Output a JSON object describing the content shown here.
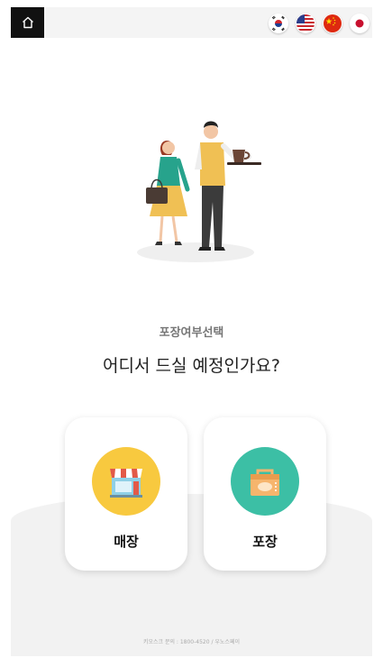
{
  "header": {
    "home_icon": "home-icon",
    "languages": [
      {
        "name": "korean-flag-icon"
      },
      {
        "name": "us-flag-icon"
      },
      {
        "name": "china-flag-icon"
      },
      {
        "name": "japan-flag-icon"
      }
    ]
  },
  "main": {
    "subtitle": "포장여부선택",
    "title": "어디서 드실 예정인가요?"
  },
  "options": [
    {
      "label": "매장",
      "icon": "store-icon",
      "color": "#f8c93f"
    },
    {
      "label": "포장",
      "icon": "takeout-box-icon",
      "color": "#3cbfa5"
    }
  ],
  "footer": {
    "text": "키오스크 문의 : 1800-4520 / 우노스페이"
  }
}
